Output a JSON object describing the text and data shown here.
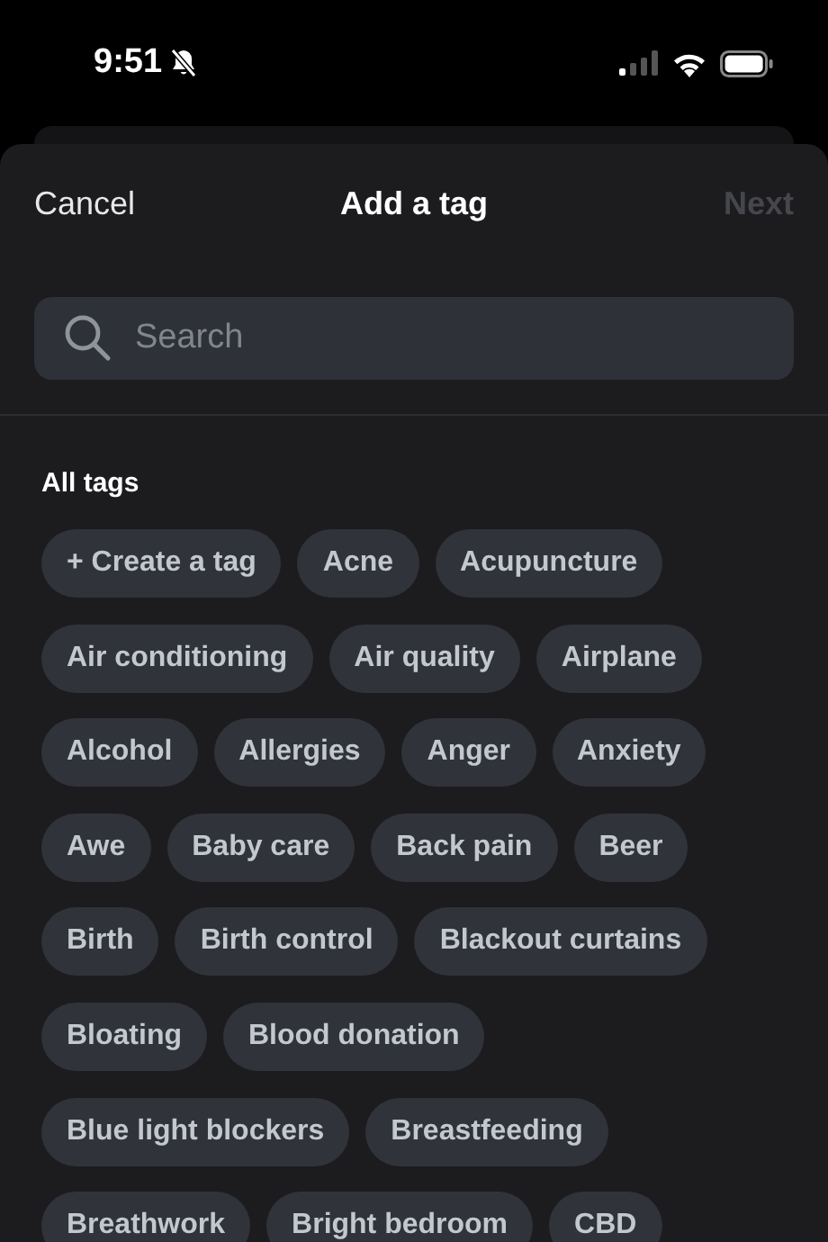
{
  "status_bar": {
    "time": "9:51"
  },
  "header": {
    "cancel": "Cancel",
    "title": "Add a tag",
    "next": {
      "label": "Next",
      "disabled": true
    }
  },
  "search": {
    "placeholder": "Search"
  },
  "section_title": "All tags",
  "tag_rows": [
    [
      "+ Create a tag",
      "Acne",
      "Acupuncture"
    ],
    [
      "Air conditioning",
      "Air quality",
      "Airplane"
    ],
    [
      "Alcohol",
      "Allergies",
      "Anger",
      "Anxiety"
    ],
    [
      "Awe",
      "Baby care",
      "Back pain",
      "Beer"
    ],
    [
      "Birth",
      "Birth control",
      "Blackout curtains"
    ],
    [
      "Bloating",
      "Blood donation"
    ],
    [
      "Blue light blockers",
      "Breastfeeding"
    ],
    [
      "Breathwork",
      "Bright bedroom",
      "CBD"
    ]
  ]
}
